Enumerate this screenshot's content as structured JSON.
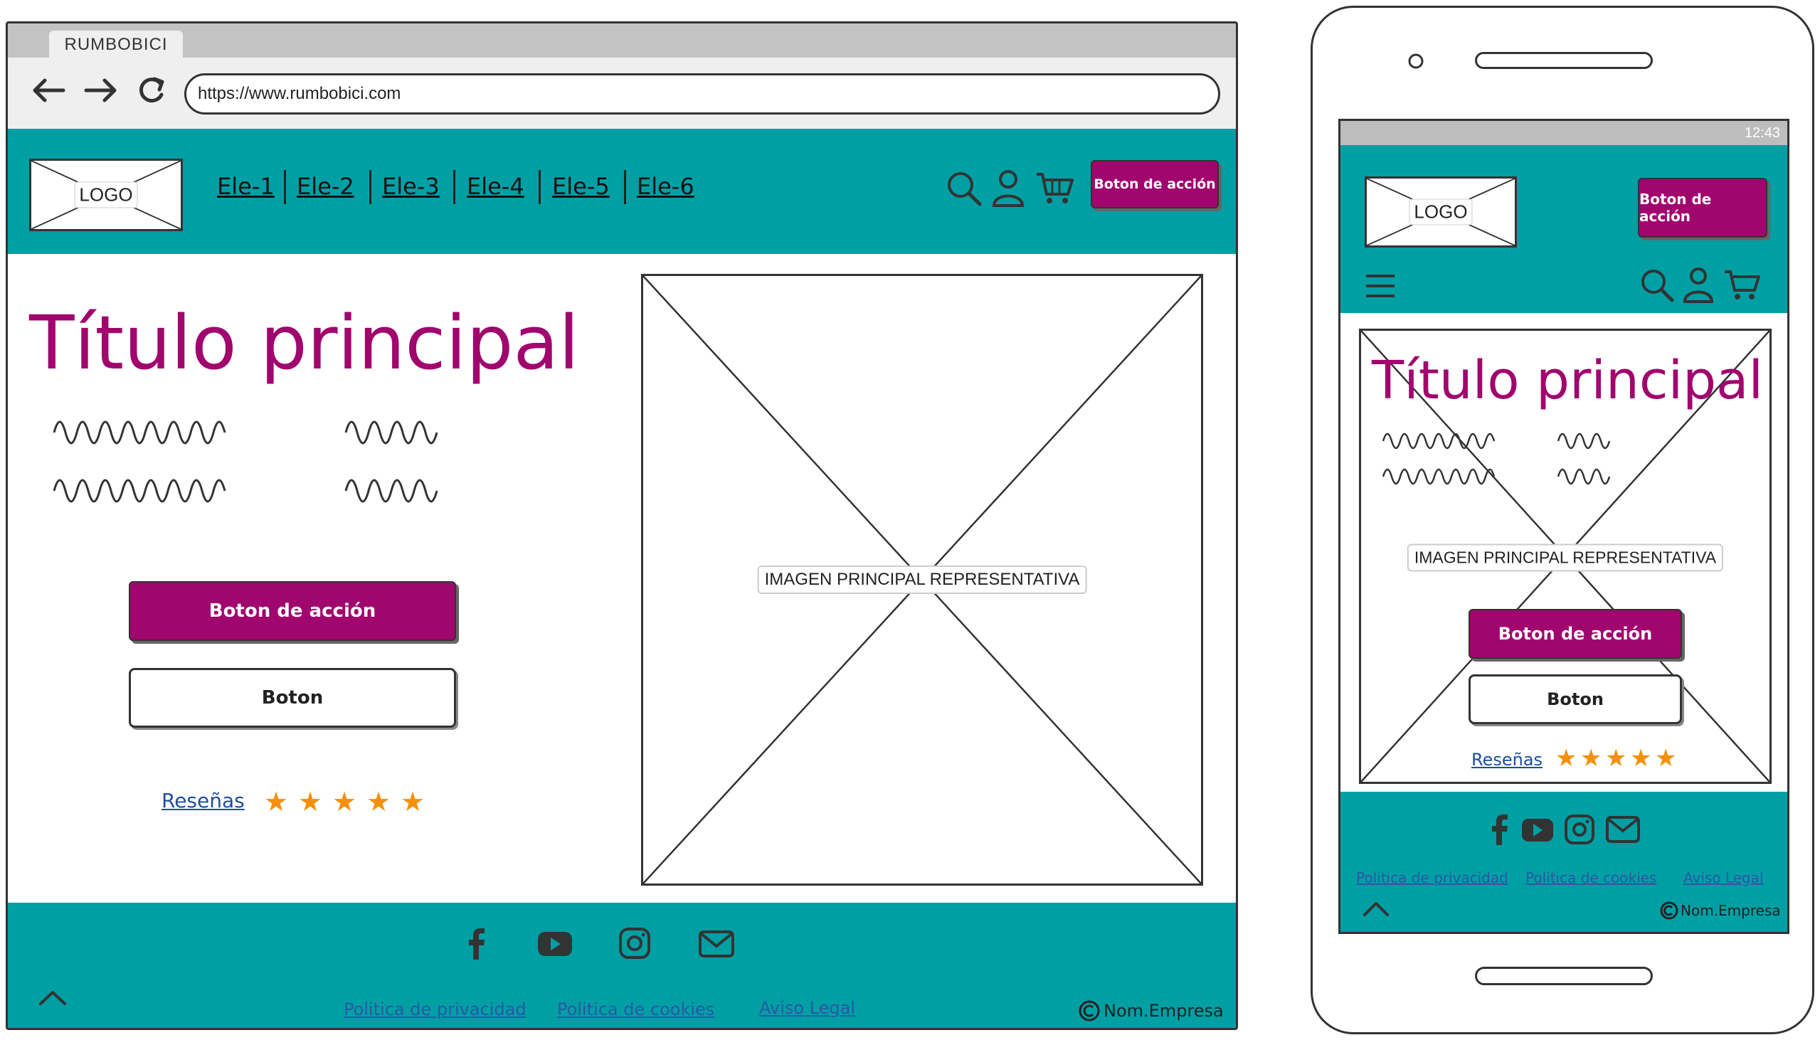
{
  "browser": {
    "tab_title": "RUMBOBICI",
    "url": "https://www.rumbobici.com",
    "nav_icons": [
      "arrow-left-icon",
      "arrow-right-icon",
      "reload-icon"
    ]
  },
  "header": {
    "logo": "LOGO",
    "nav": [
      "Ele-1",
      "Ele-2",
      "Ele-3",
      "Ele-4",
      "Ele-5",
      "Ele-6"
    ],
    "icons": [
      "search-icon",
      "user-icon",
      "cart-icon"
    ],
    "cta": "Boton de acción"
  },
  "hero": {
    "title": "Título principal",
    "primary_button": "Boton de acción",
    "secondary_button": "Boton",
    "reviews_link": "Reseñas",
    "stars": 5,
    "image_label": "IMAGEN PRINCIPAL REPRESENTATIVA"
  },
  "footer": {
    "social": [
      "facebook-icon",
      "youtube-icon",
      "instagram-icon",
      "mail-icon"
    ],
    "links": [
      "Politica de privacidad",
      "Politica de cookies",
      "Aviso Legal"
    ],
    "copyright": "Nom.Empresa"
  },
  "mobile": {
    "status_time": "12:43",
    "logo": "LOGO",
    "cta": "Boton de acción",
    "title": "Título principal",
    "image_label": "IMAGEN PRINCIPAL REPRESENTATIVA",
    "primary_button": "Boton de acción",
    "secondary_button": "Boton",
    "reviews_link": "Reseñas",
    "footer_links": [
      "Politica de privacidad",
      "Politica de cookies",
      "Aviso Legal"
    ],
    "copyright": "Nom.Empresa"
  },
  "colors": {
    "brand_teal": "#009fa4",
    "accent_magenta": "#a0066e",
    "star_orange": "#f4900c",
    "link_blue": "#2a58a6"
  }
}
